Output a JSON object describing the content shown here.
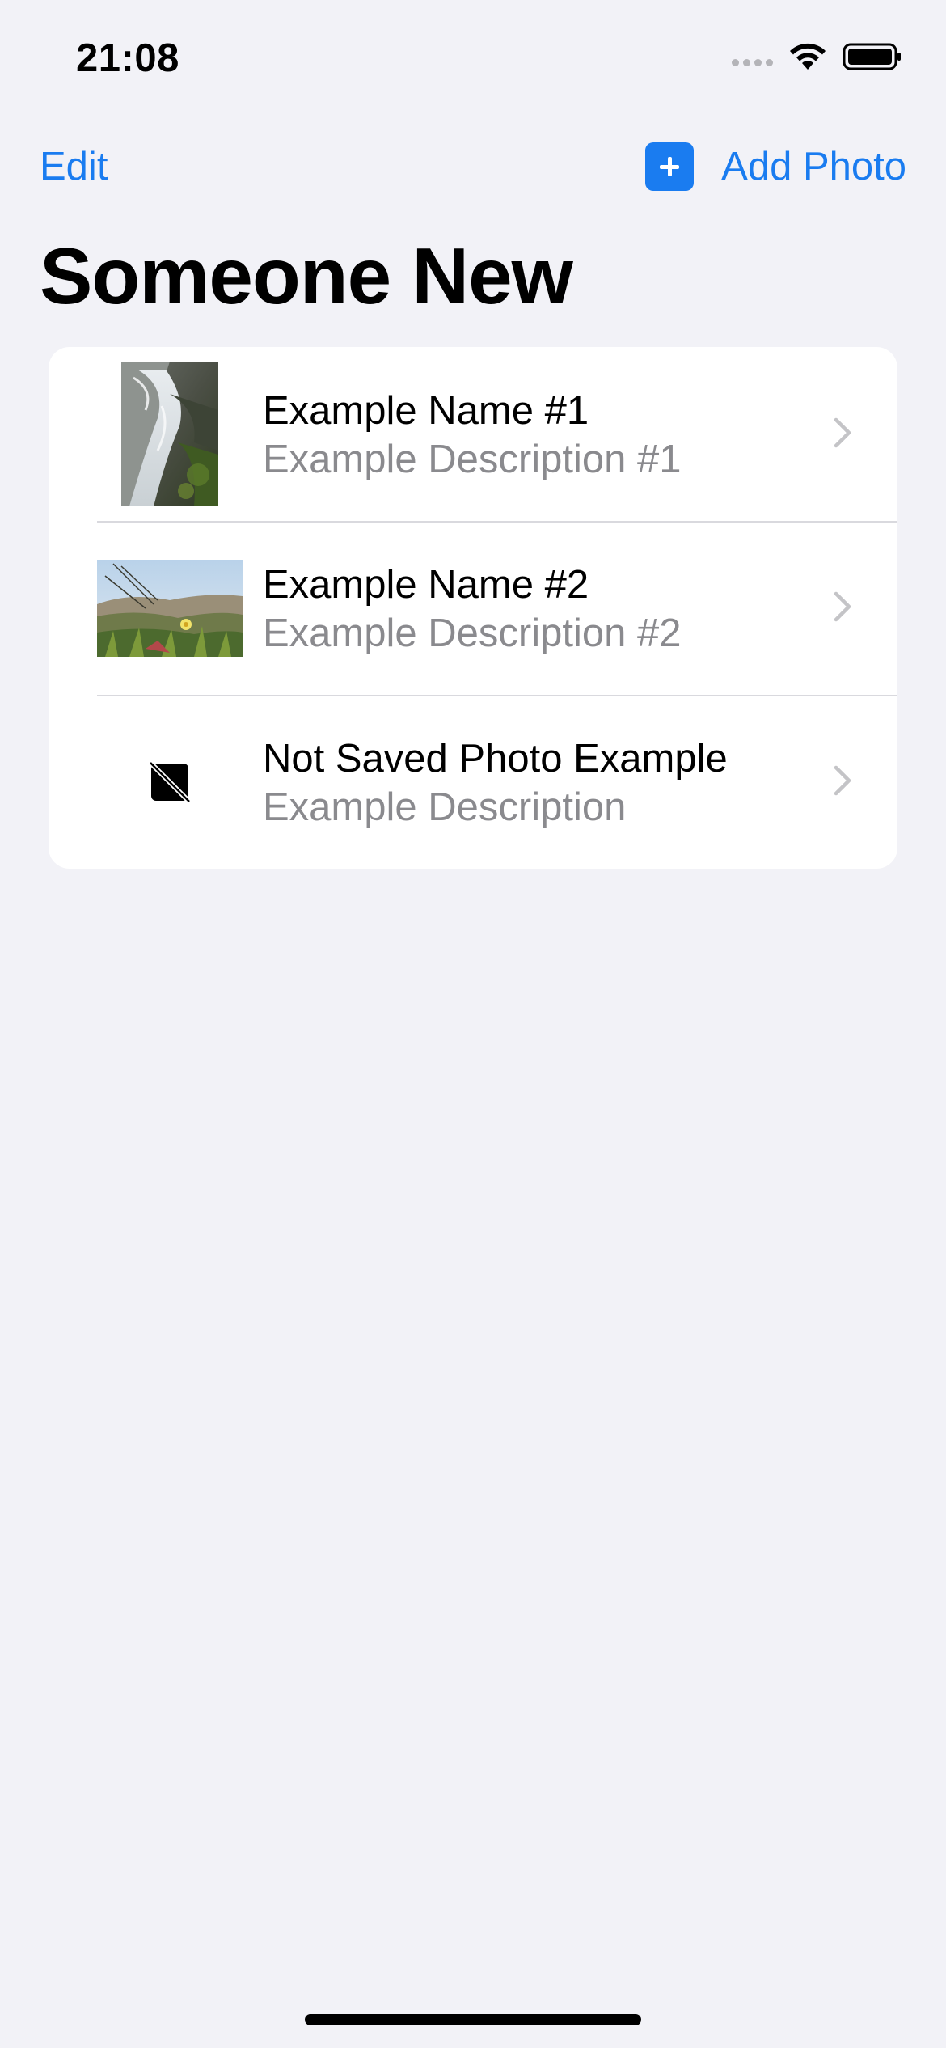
{
  "status_bar": {
    "time": "21:08",
    "icons": [
      "cellular-signal-icon",
      "wifi-icon",
      "battery-icon"
    ]
  },
  "nav": {
    "edit_label": "Edit",
    "add_icon": "plus-square-icon",
    "add_label": "Add Photo"
  },
  "title": "Someone New",
  "colors": {
    "accent": "#1a7cf0",
    "background": "#f2f2f7",
    "card": "#ffffff",
    "secondary_text": "#8a8a8e",
    "separator": "#d9d9de"
  },
  "items": [
    {
      "name": "Example Name #1",
      "description": "Example Description #1",
      "thumbnail": "waterfall-photo"
    },
    {
      "name": "Example Name #2",
      "description": "Example Description #2",
      "thumbnail": "landscape-flower-photo"
    },
    {
      "name": "Not Saved Photo Example",
      "description": "Example Description",
      "thumbnail": "photo-unavailable-icon"
    }
  ]
}
